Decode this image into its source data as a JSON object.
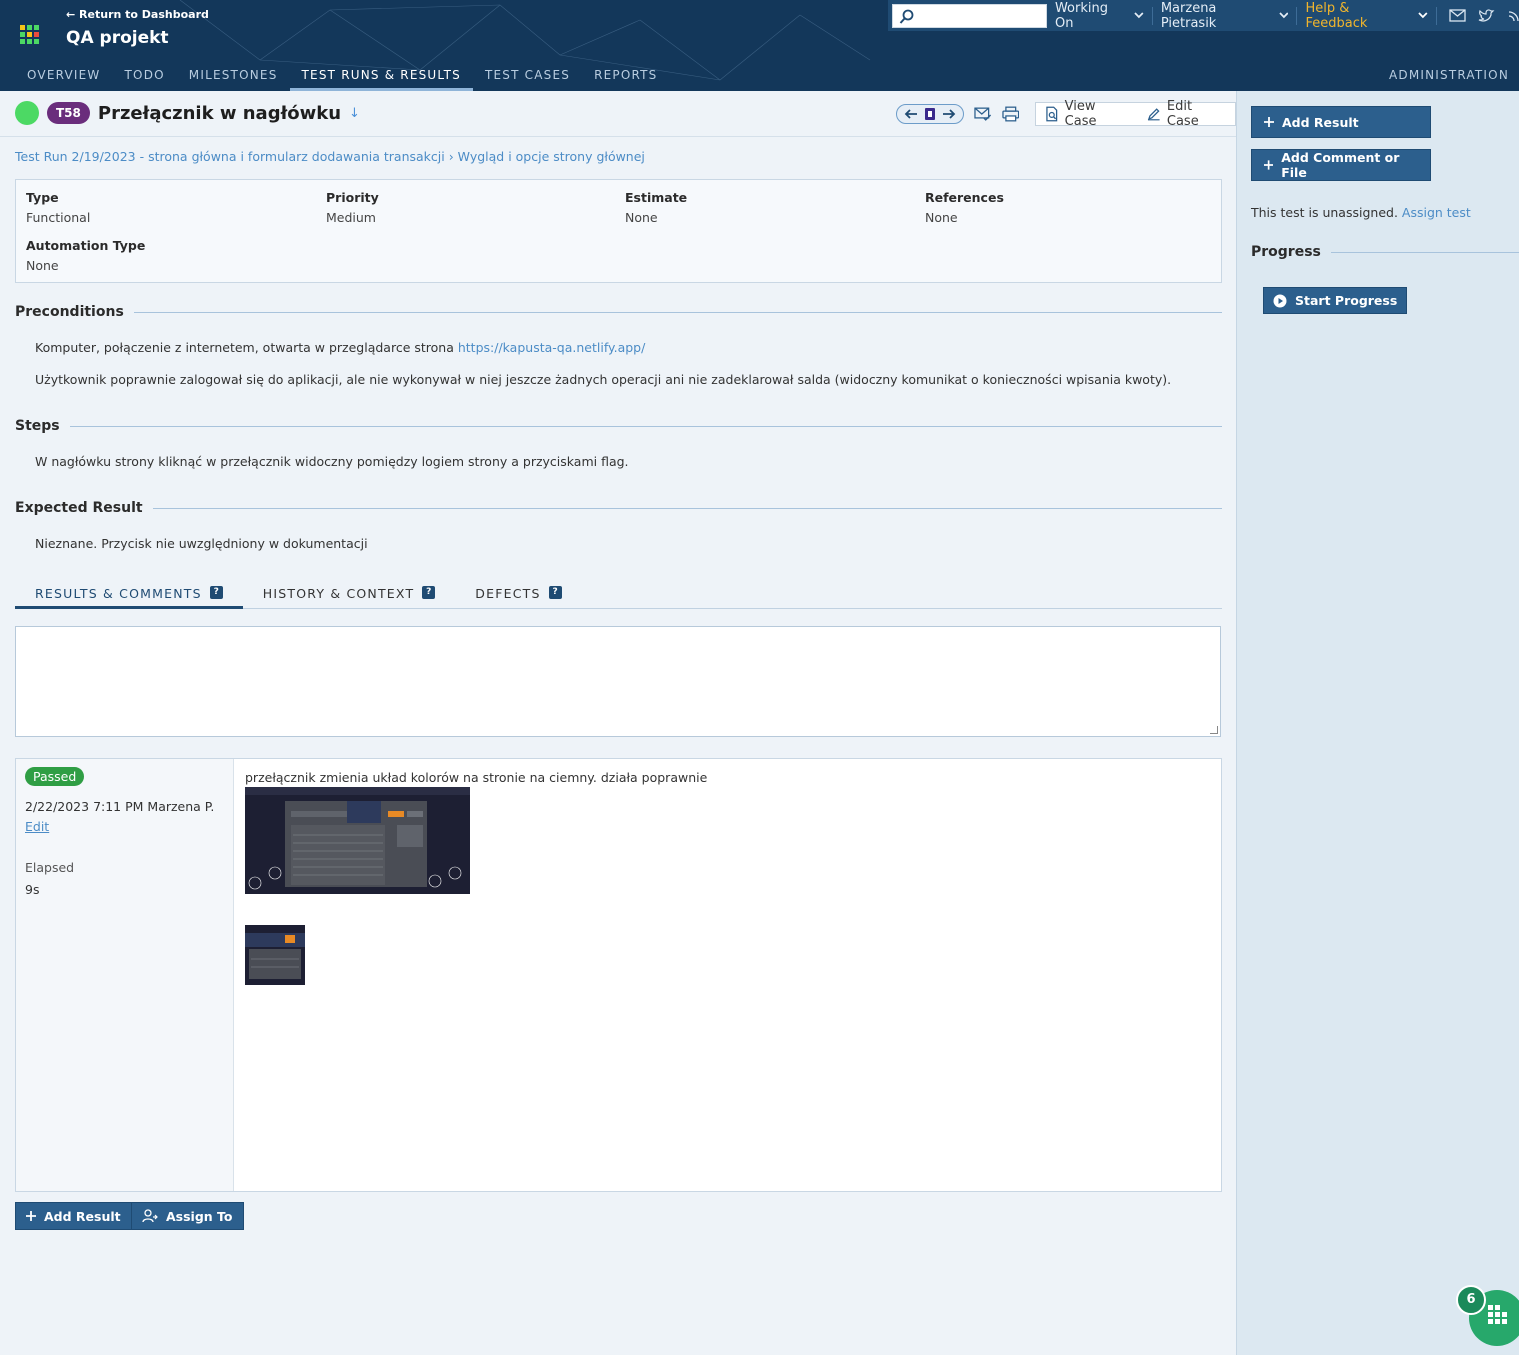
{
  "header": {
    "return_link": "← Return to Dashboard",
    "project": "QA projekt",
    "nav": [
      "OVERVIEW",
      "TODO",
      "MILESTONES",
      "TEST RUNS & RESULTS",
      "TEST CASES",
      "REPORTS"
    ],
    "admin": "ADMINISTRATION",
    "working_on": "Working On",
    "user": "Marzena Pietrasik",
    "help": "Help & Feedback"
  },
  "case": {
    "id": "T58",
    "title": "Przełącznik w nagłówku",
    "status_color": "#4cd964",
    "view_case": "View Case",
    "edit_case": "Edit Case"
  },
  "breadcrumb": "Test Run 2/19/2023 - strona główna i formularz dodawania transakcji › Wygląd i opcje strony głównej",
  "fields": {
    "type_label": "Type",
    "type_value": "Functional",
    "priority_label": "Priority",
    "priority_value": "Medium",
    "estimate_label": "Estimate",
    "estimate_value": "None",
    "references_label": "References",
    "references_value": "None",
    "automation_label": "Automation Type",
    "automation_value": "None"
  },
  "preconditions": {
    "heading": "Preconditions",
    "line1_text": "Komputer, połączenie z internetem, otwarta w przeglądarce strona ",
    "line1_link": "https://kapusta-qa.netlify.app/",
    "line2": "Użytkownik poprawnie zalogował się do aplikacji, ale nie wykonywał w niej jeszcze żadnych operacji ani nie zadeklarował salda (widoczny komunikat o konieczności wpisania kwoty)."
  },
  "steps": {
    "heading": "Steps",
    "text": "W nagłówku strony kliknąć w przełącznik widoczny pomiędzy logiem strony a przyciskami flag."
  },
  "expected": {
    "heading": "Expected Result",
    "text": "Nieznane. Przycisk nie uwzględniony w dokumentacji"
  },
  "tabs": [
    "RESULTS & COMMENTS",
    "HISTORY & CONTEXT",
    "DEFECTS"
  ],
  "result": {
    "status": "Passed",
    "status_color": "#2f9e44",
    "meta": "2/22/2023 7:11 PM Marzena P.",
    "edit": "Edit",
    "elapsed_label": "Elapsed",
    "elapsed_value": "9s",
    "comment": "przełącznik zmienia układ kolorów na stronie na ciemny. działa poprawnie"
  },
  "buttons": {
    "add_result": "Add Result",
    "assign_to": "Assign To"
  },
  "sidebar": {
    "add_result": "Add Result",
    "add_comment": "Add Comment or File",
    "unassigned_text": "This test is unassigned. ",
    "assign_link": "Assign test",
    "progress_heading": "Progress",
    "start_progress": "Start Progress"
  },
  "fab": {
    "badge": "6"
  }
}
